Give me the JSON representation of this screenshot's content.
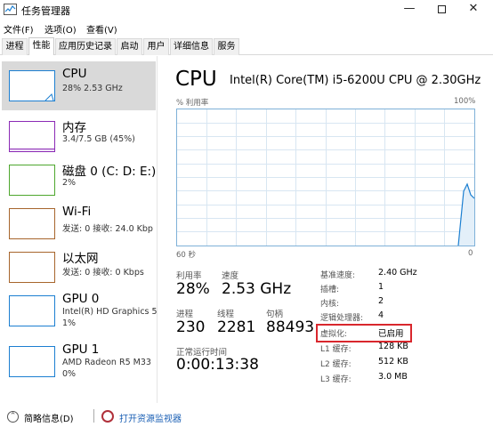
{
  "window": {
    "title": "任务管理器",
    "minimize_label": "—",
    "close_label": "✕"
  },
  "menu": [
    "文件(F)",
    "选项(O)",
    "查看(V)"
  ],
  "tabs": [
    {
      "label": "进程"
    },
    {
      "label": "性能",
      "active": true
    },
    {
      "label": "应用历史记录"
    },
    {
      "label": "启动"
    },
    {
      "label": "用户"
    },
    {
      "label": "详细信息"
    },
    {
      "label": "服务"
    }
  ],
  "sidebar": {
    "items": [
      {
        "name": "CPU",
        "sub": "28% 2.53 GHz",
        "sub2": "",
        "color": "#1c7fd1",
        "active": true
      },
      {
        "name": "内存",
        "sub": "3.4/7.5 GB (45%)",
        "sub2": "",
        "color": "#8b2ab5"
      },
      {
        "name": "磁盘 0 (C: D: E:)",
        "sub": "2%",
        "sub2": "",
        "color": "#4ea72e"
      },
      {
        "name": "Wi-Fi",
        "sub": "发送: 0 接收: 24.0 Kbp",
        "sub2": "",
        "color": "#a7652c"
      },
      {
        "name": "以太网",
        "sub": "发送: 0 接收: 0 Kbps",
        "sub2": "",
        "color": "#a7652c"
      },
      {
        "name": "GPU 0",
        "sub": "Intel(R) HD Graphics 5",
        "sub2": "1%",
        "color": "#1c7fd1"
      },
      {
        "name": "GPU 1",
        "sub": "AMD Radeon R5 M33",
        "sub2": "0%",
        "color": "#1c7fd1"
      }
    ]
  },
  "main": {
    "title": "CPU",
    "model": "Intel(R) Core(TM) i5-6200U CPU @ 2.30GHz",
    "graph_label_left": "% 利用率",
    "graph_label_right": "100%",
    "axis_left": "60 秒",
    "axis_right": "0",
    "graph_color": "#7fb1d8",
    "stats": {
      "util_label": "利用率",
      "util_value": "28%",
      "speed_label": "速度",
      "speed_value": "2.53 GHz",
      "proc_label": "进程",
      "proc_value": "230",
      "thread_label": "线程",
      "thread_value": "2281",
      "handle_label": "句柄",
      "handle_value": "88493",
      "uptime_label": "正常运行时间",
      "uptime_value": "0:00:13:38"
    },
    "details": [
      {
        "key": "基准速度:",
        "value": "2.40 GHz"
      },
      {
        "key": "插槽:",
        "value": "1"
      },
      {
        "key": "内核:",
        "value": "2"
      },
      {
        "key": "逻辑处理器:",
        "value": "4"
      },
      {
        "key": "虚拟化:",
        "value": "已启用"
      },
      {
        "key": "L1 缓存:",
        "value": "128 KB"
      },
      {
        "key": "L2 缓存:",
        "value": "512 KB"
      },
      {
        "key": "L3 缓存:",
        "value": "3.0 MB"
      }
    ],
    "highlight_color": "#d9272d"
  },
  "footer": {
    "fewer_details": "简略信息(D)",
    "open_monitor": "打开资源监视器"
  }
}
